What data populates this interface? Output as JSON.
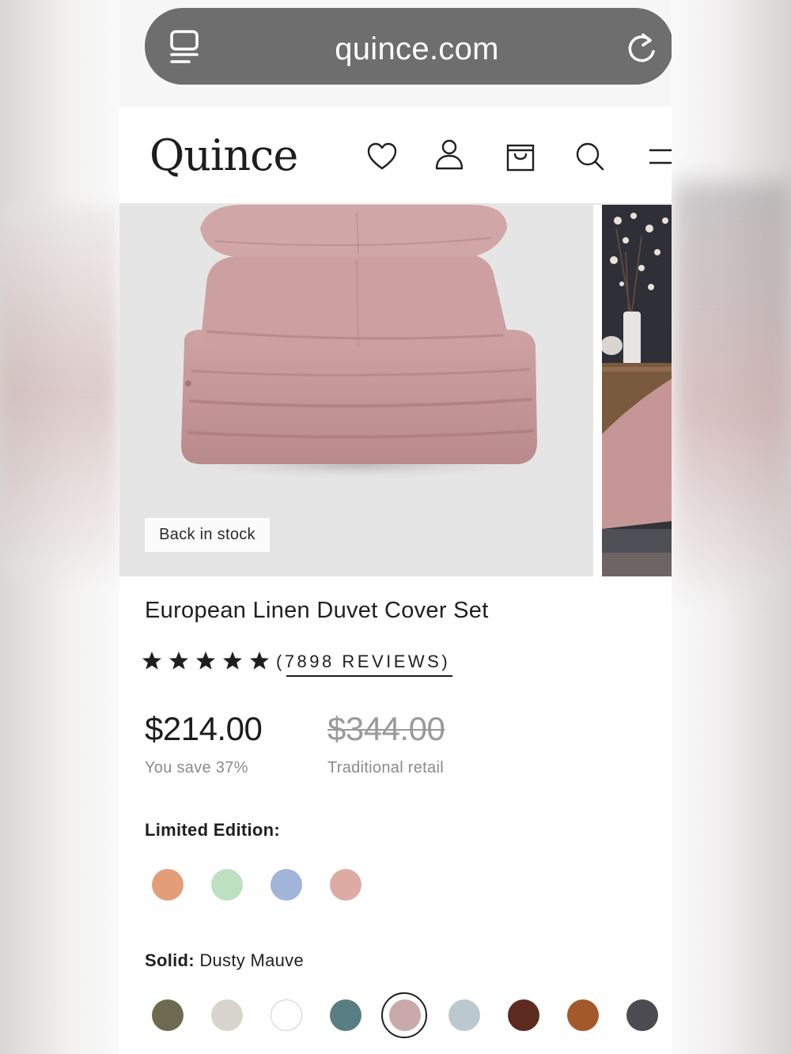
{
  "browser": {
    "url": "quince.com"
  },
  "header": {
    "logo": "Quince",
    "icons": [
      "heart-icon",
      "account-icon",
      "bag-icon",
      "search-icon",
      "menu-icon"
    ]
  },
  "gallery": {
    "badge": "Back in stock"
  },
  "product": {
    "title": "European Linen Duvet Cover Set",
    "rating": 5,
    "reviews": "(7898 REVIEWS)",
    "price": "$214.00",
    "save_note": "You save 37%",
    "retail_price": "$344.00",
    "retail_label": "Traditional retail"
  },
  "options": {
    "limited_label": "Limited Edition:",
    "limited_colors": [
      "#e39d78",
      "#bde0c0",
      "#a1b5d9",
      "#deaba4"
    ],
    "solid_label": "Solid:",
    "solid_selected": "Dusty Mauve",
    "solid_colors": [
      "#6e6a52",
      "#d6d4cc",
      "#ffffff",
      "#587d82",
      "#c9a9a9",
      "#bcc8cf",
      "#5d2a20",
      "#a4592a",
      "#4c4b51"
    ],
    "selected_index": 4
  }
}
